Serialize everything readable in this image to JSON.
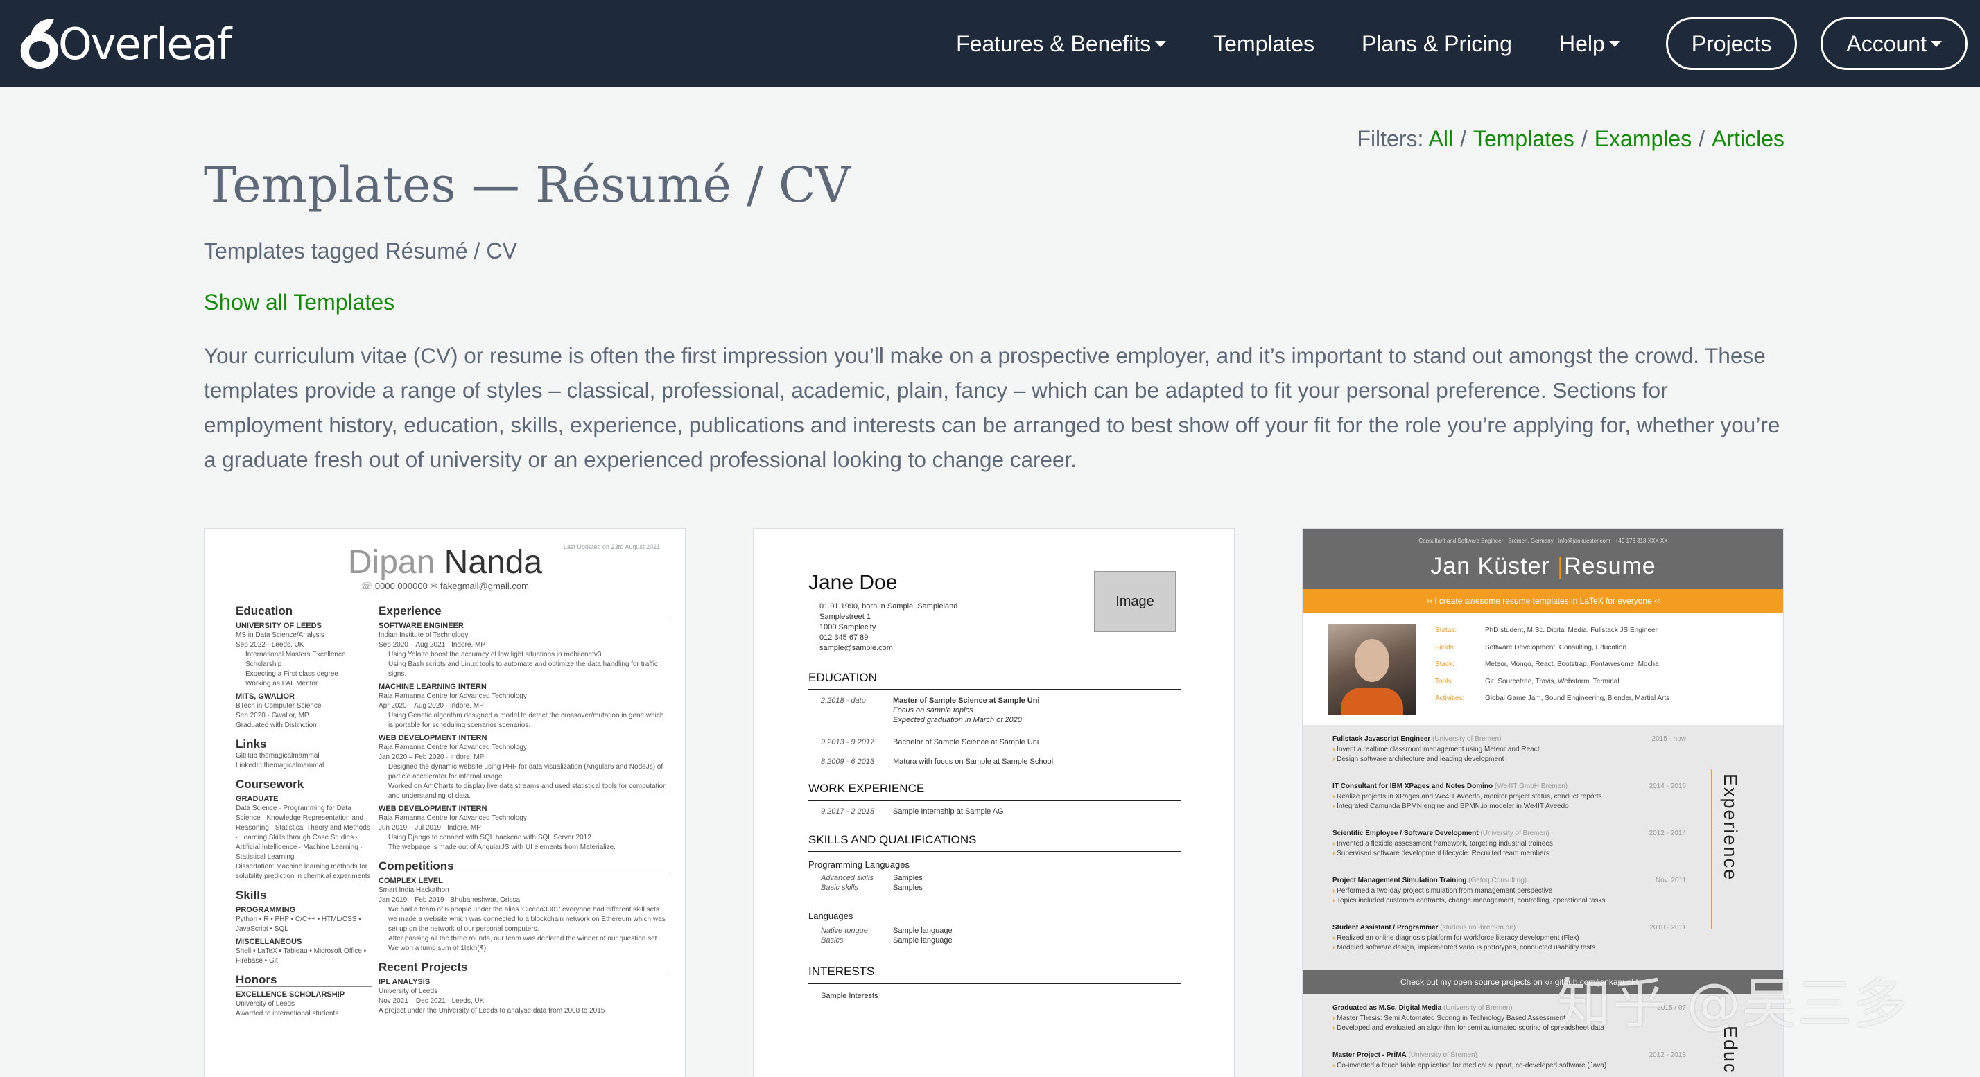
{
  "nav": {
    "brand": "Overleaf",
    "items": [
      {
        "label": "Features & Benefits",
        "caret": true
      },
      {
        "label": "Templates",
        "caret": false
      },
      {
        "label": "Plans & Pricing",
        "caret": false
      },
      {
        "label": "Help",
        "caret": true
      }
    ],
    "projects_label": "Projects",
    "account_label": "Account",
    "bg_color": "#1e2a3a"
  },
  "filters": {
    "label": "Filters:",
    "links": [
      "All",
      "Templates",
      "Examples",
      "Articles"
    ],
    "link_color": "#138a07"
  },
  "page": {
    "title": "Templates — Résumé / CV",
    "subtitle": "Templates tagged Résumé / CV",
    "show_all": "Show all Templates",
    "description": "Your curriculum vitae (CV) or resume is often the first impression you’ll make on a prospective employer, and it’s important to stand out amongst the crowd. These templates provide a range of styles – classical, professional, academic, plain, fancy – which can be adapted to fit your personal preference. Sections for employment history, education, skills, experience, publications and interests can be arranged to best show off your fit for the role you’re applying for, whether you’re a graduate fresh out of university or an experienced professional looking to change career."
  },
  "card1": {
    "updated": "Last Updated on 23rd August 2021",
    "name_first": "Dipan",
    "name_last": "Nanda",
    "contact": "☏ 0000 000000   ✉ fakegmail@gmail.com",
    "education_h": "Education",
    "edu1": "University of Leeds",
    "edu1_deg": "MS in Data Science/Analysis",
    "edu1_date": "Sep 2022 · Leeds, UK",
    "edu1_b1": "International Masters Excellence Scholarship",
    "edu1_b2": "Expecting a First class degree",
    "edu1_b3": "Working as PAL Mentor",
    "edu2": "MITS, Gwalior",
    "edu2_deg": "BTech in Computer Science",
    "edu2_date": "Sep 2020 · Gwalior, MP",
    "edu2_note": "Graduated with Distinction",
    "links_h": "Links",
    "link1": "GitHub  themagicalmammal",
    "link2": "LinkedIn  themagicalmammal",
    "course_h": "Coursework",
    "course_sub": "Graduate",
    "course_items": "Data Science · Programming for Data Science · Knowledge Representation and Reasoning · Statistical Theory and Methods · Learning Skills through Case Studies · Artificial Intelligence · Machine Learning · Statistical Learning",
    "course_diss": "Dissertation: Machine learning methods for solubility prediction in chemical experiments",
    "skills_h": "Skills",
    "skills_prog": "Programming",
    "skills_prog_t": "Python • R • PHP • C/C++ • HTML/CSS • JavaScript • SQL",
    "skills_misc": "Miscellaneous",
    "skills_misc_t": "Shell • LaTeX • Tableau • Microsoft Office • Firebase • Git",
    "honors_h": "Honors",
    "honors_sub": "Excellence Scholarship",
    "honors_t": "University of Leeds",
    "honors_t2": "Awarded to international students",
    "exp_h": "Experience",
    "exp1": "Software Engineer",
    "exp1_org": "Indian Institute of Technology",
    "exp1_date": "Sep 2020 – Aug 2021 · Indore, MP",
    "exp1_b1": "Using Yolo to boost the accuracy of low light situations in mobilenetv3",
    "exp1_b2": "Using Bash scripts and Linux tools to automate and optimize the data handling for traffic signs.",
    "exp2": "Machine Learning Intern",
    "exp2_org": "Raja Ramanna Centre for Advanced Technology",
    "exp2_date": "Apr 2020 – Aug 2020 · Indore, MP",
    "exp2_b1": "Using Genetic algorithm designed a model to detect the crossover/mutation in gene which is portable for scheduling scenarios scenarios.",
    "exp3": "Web Development Intern",
    "exp3_org": "Raja Ramanna Centre for Advanced Technology",
    "exp3_date": "Jan 2020 – Feb 2020 · Indore, MP",
    "exp3_b1": "Designed the dynamic website using PHP for data visualization (Angular5 and NodeJs) of particle accelerator for internal usage.",
    "exp3_b2": "Worked on AmCharts to display live data streams and used statistical tools for computation and understanding of data.",
    "exp4": "Web Development Intern",
    "exp4_org": "Raja Ramanna Centre for Advanced Technology",
    "exp4_date": "Jun 2019 – Jul 2019 · Indore, MP",
    "exp4_b1": "Using Django to connect with SQL backend with SQL Server 2012.",
    "exp4_b2": "The webpage is made out of AngularJS with UI elements from Materialize.",
    "comp_h": "Competitions",
    "comp_sub": "Complex Level",
    "comp_org": "Smart India Hackathon",
    "comp_date": "Jan 2019 – Feb 2019 · Bhubaneshwar, Orissa",
    "comp_b1": "We had a team of 6 people under the alias 'Cicada3301' everyone had different skill sets we made a website which was connected to a blockchain network on Ethereum which was set up on the network of our personal computers.",
    "comp_b2": "After passing all the three rounds, our team was declared the winner of our question set. We won a lump sum of 1lakh(₹).",
    "proj_h": "Recent Projects",
    "proj_sub": "IPL Analysis",
    "proj_org": "University of Leeds",
    "proj_date": "Nov 2021 – Dec 2021 · Leeds, UK",
    "proj_t": "A project under the University of Leeds to analyse data from 2008 to 2015"
  },
  "card2": {
    "name": "Jane Doe",
    "photo": "Image",
    "info": [
      "01.01.1990, born in Sample, Sampleland",
      "Samplestreet 1",
      "1000 Samplecity",
      "012 345 67 89",
      "sample@sample.com"
    ],
    "education_h": "EDUCATION",
    "edu": [
      {
        "date": "2.2018 - dato",
        "what": "Master of Sample Science at Sample Uni",
        "l2": "Focus on sample topics",
        "l3": "Expected graduation in March of 2020"
      },
      {
        "date": "9.2013 - 9.2017",
        "what": "Bachelor of Sample Science at Sample Uni"
      },
      {
        "date": "8.2009 - 6.2013",
        "what": "Matura with focus on Sample at Sample School"
      }
    ],
    "work_h": "WORK EXPERIENCE",
    "work": [
      {
        "date": "9.2017 - 2.2018",
        "what": "Sample Internship at Sample AG"
      }
    ],
    "skills_h": "SKILLS AND QUALIFICATIONS",
    "prog_h": "Programming Languages",
    "prog": [
      {
        "date": "Advanced skills",
        "what": "Samples"
      },
      {
        "date": "Basic skills",
        "what": "Samples"
      }
    ],
    "lang_h": "Languages",
    "lang": [
      {
        "date": "Native tongue",
        "what": "Sample language"
      },
      {
        "date": "Basics",
        "what": "Sample language"
      }
    ],
    "interests_h": "INTERESTS",
    "interests": "Sample Interests"
  },
  "card3": {
    "contact": "Consultant and Software Engineer · Bremen, Germany · info@jankuester.com · +49 176 313 XXX XX",
    "name_first": "Jan Küster",
    "name_last": "Resume",
    "tagline": "›› I create awesome resume templates in LaTeX for everyone ‹‹",
    "facts": [
      {
        "k": "Status:",
        "v": "PhD student, M.Sc. Digital Media, Fullstack JS Engineer"
      },
      {
        "k": "Fields:",
        "v": "Software Development, Consulting, Education"
      },
      {
        "k": "Stack:",
        "v": "Meteor, Mongo, React, Bootstrap, Fontawesome, Mocha"
      },
      {
        "k": "Tools:",
        "v": "Git, Sourcetree, Travis, Webstorm, Terminal"
      },
      {
        "k": "Activities:",
        "v": "Global Game Jam, Sound Engineering, Blender, Martial Arts"
      }
    ],
    "exp": [
      {
        "t": "Fullstack Javascript Engineer",
        "co": "(University of Bremen)",
        "dt": "2015 - now",
        "b": [
          "Invent a realtime classroom management using Meteor and React",
          "Design software architecture and leading development"
        ]
      },
      {
        "t": "IT Consultant for IBM XPages and Notes Domino",
        "co": "(We4IT GmbH Bremen)",
        "dt": "2014 - 2016",
        "b": [
          "Realize projects in XPages and We4IT Aveedo, monitor project status, conduct reports",
          "Integrated Camunda BPMN engine and BPMN.io modeler in We4IT Aveedo"
        ]
      },
      {
        "t": "Scientific Employee / Software Development",
        "co": "(University of Bremen)",
        "dt": "2012 - 2014",
        "b": [
          "Invented a flexible assessment framework, targeting industrial trainees",
          "Supervised software development lifecycle. Recruited team members"
        ]
      },
      {
        "t": "Project Management Simulation Training",
        "co": "(Getoq Consulting)",
        "dt": "Nov. 2011",
        "b": [
          "Performed a two-day project simulation from management perspective",
          "Topics included customer contracts, change management, controlling, operational tasks"
        ]
      },
      {
        "t": "Student Assistant / Programmer",
        "co": "(studeus.uni-bremen.de)",
        "dt": "2010 - 2011",
        "b": [
          "Realized an online diagnosis platform for workforce literacy development (Flex)",
          "Modeled software design, implemented various prototypes, conducted usability tests"
        ]
      }
    ],
    "exp_label": "Experience",
    "darkbar": "Check out my open source projects on ‹/› github.com/jankapunkt",
    "edu": [
      {
        "t": "Graduated as M.Sc. Digital Media",
        "co": "(University of Bremen)",
        "dt": "2015 / 07",
        "b": [
          "Master Thesis: Semi Automated Scoring in Technology Based Assessment",
          "Developed and evaluated an algorithm for semi automated scoring of spreadsheet data"
        ]
      },
      {
        "t": "Master Project - PriMA",
        "co": "(University of Bremen)",
        "dt": "2012 - 2013",
        "b": [
          "Co-invented a touch table application for medical support, co-developed software (Java)"
        ]
      }
    ],
    "edu_label": "Educ"
  },
  "watermark": "知乎 @吴三多"
}
